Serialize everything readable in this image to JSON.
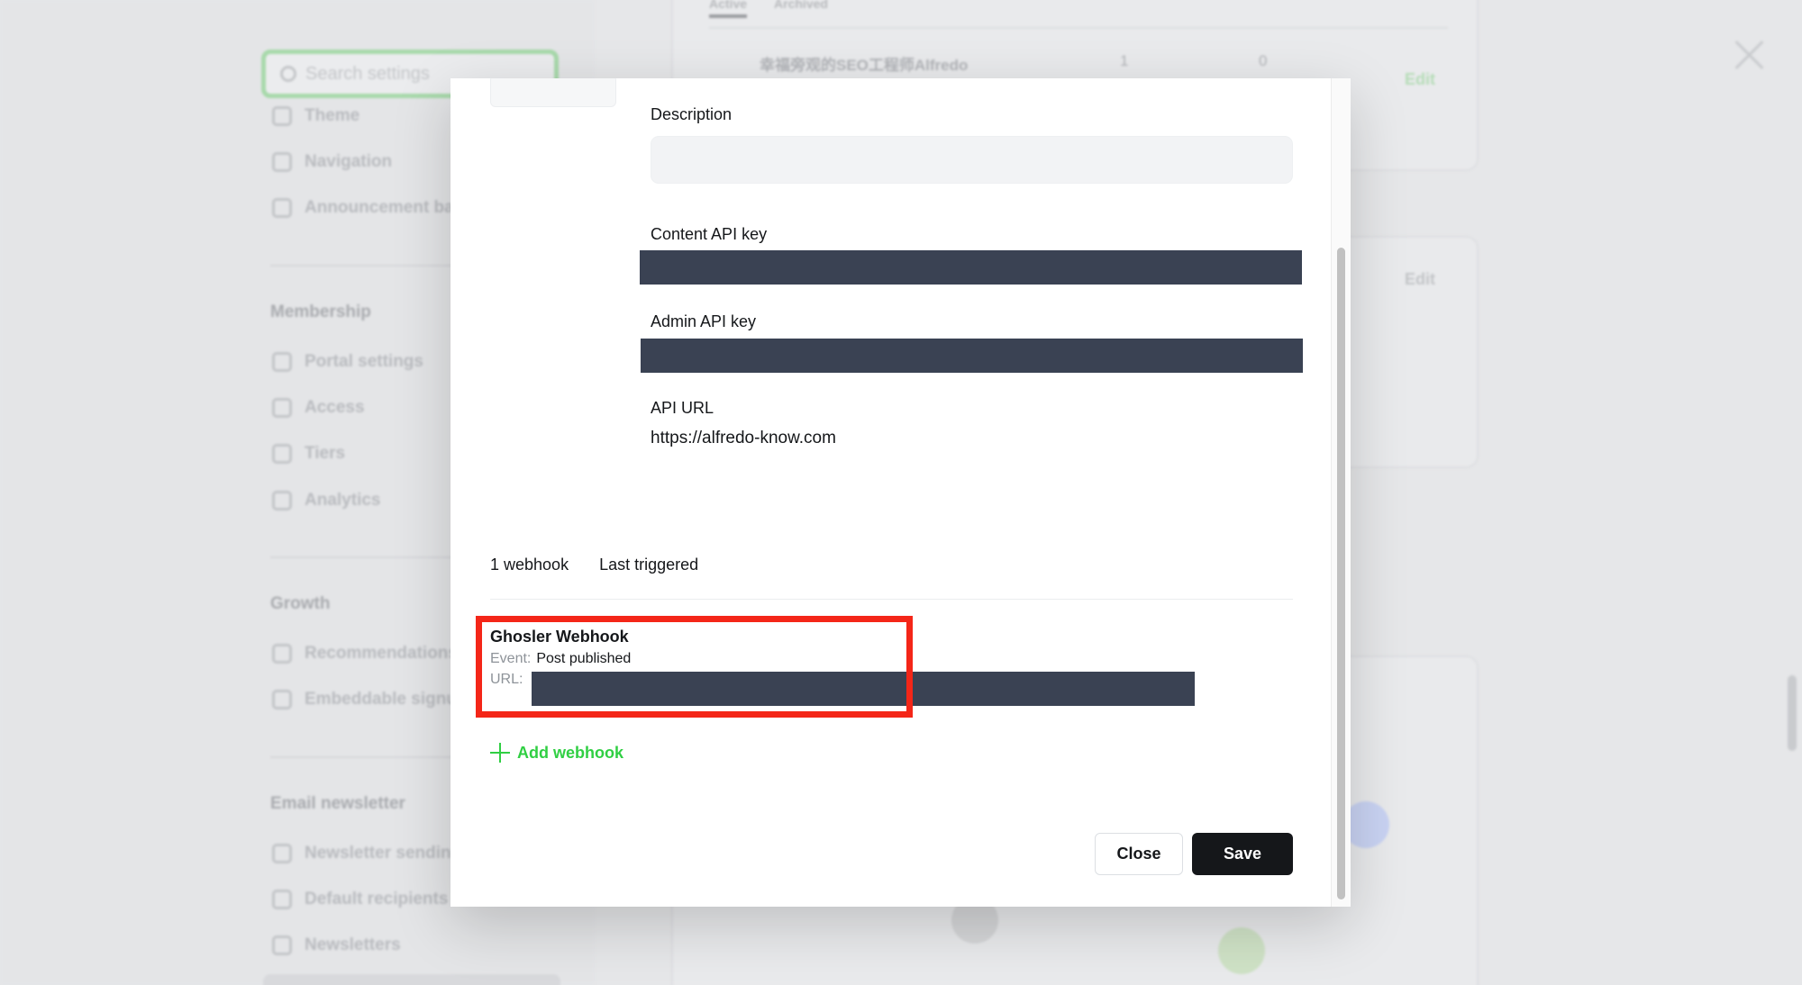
{
  "background": {
    "search_placeholder": "Search settings",
    "nav_top": [
      "Theme",
      "Navigation",
      "Announcement bar"
    ],
    "sections": [
      {
        "title": "Membership",
        "items": [
          "Portal settings",
          "Access",
          "Tiers",
          "Analytics"
        ]
      },
      {
        "title": "Growth",
        "items": [
          "Recommendations",
          "Embeddable signup form"
        ]
      },
      {
        "title": "Email newsletter",
        "items": [
          "Newsletter sending",
          "Default recipients",
          "Newsletters"
        ]
      }
    ],
    "edit_label": "Edit",
    "tabs": [
      "Active",
      "Archived"
    ],
    "integration_row": {
      "name": "幸福旁观的SEO工程师Alfredo",
      "col1": "1",
      "col2": "0"
    }
  },
  "modal": {
    "description_label": "Description",
    "description_value": "",
    "content_api_key_label": "Content API key",
    "admin_api_key_label": "Admin API key",
    "api_url_label": "API URL",
    "api_url_value": "https://alfredo-know.com",
    "webhook_count": "1 webhook",
    "last_triggered_label": "Last triggered",
    "webhook": {
      "name": "Ghosler Webhook",
      "event_label": "Event:",
      "event_value": "Post published",
      "url_label": "URL:"
    },
    "add_webhook_label": "Add webhook",
    "close_label": "Close",
    "save_label": "Save"
  },
  "colors": {
    "accent_green": "#30cf43",
    "redaction": "#3a4253",
    "highlight_red": "#f42618",
    "primary_button": "#15171a"
  }
}
